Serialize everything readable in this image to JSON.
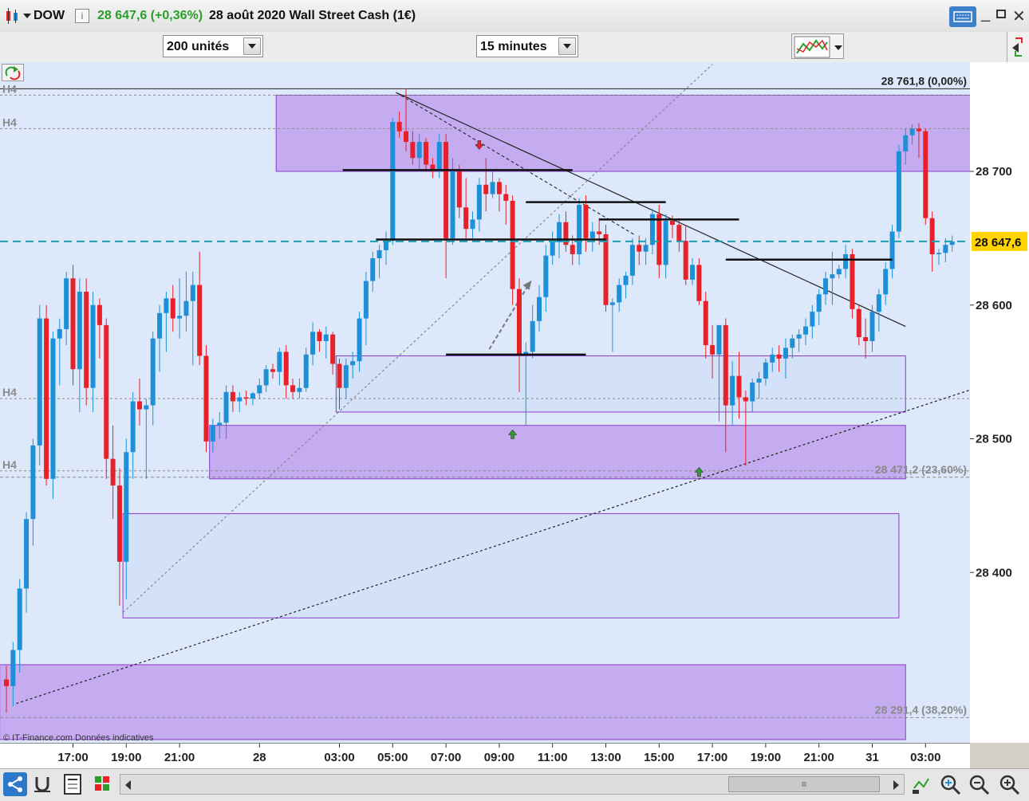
{
  "window": {
    "symbol": "DOW",
    "price_change": "28 647,6 (+0,36%)",
    "title": "28 août 2020 Wall Street Cash (1€)"
  },
  "toolbar": {
    "units": "200 unités",
    "timeframe": "15 minutes"
  },
  "watermark": "© IT-Finance.com Données indicatives",
  "colors": {
    "up": "#1e90d8",
    "down": "#e8202a",
    "zone_purple": "#c3a8ee",
    "zone_blue": "#d2e1f8",
    "last_line": "#1aa0b0",
    "last_tag": "#ffd400"
  },
  "chart_data": {
    "type": "candlestick",
    "ylim": [
      28291.4,
      28775
    ],
    "y_ticks": [
      {
        "value": 28700,
        "label": "28 700"
      },
      {
        "value": 28600,
        "label": "28 600"
      },
      {
        "value": 28500,
        "label": "28 500"
      },
      {
        "value": 28400,
        "label": "28 400"
      }
    ],
    "x_ticks": [
      {
        "i": 10,
        "label": "17:00"
      },
      {
        "i": 18,
        "label": "19:00"
      },
      {
        "i": 26,
        "label": "21:00"
      },
      {
        "i": 38,
        "label": "28"
      },
      {
        "i": 50,
        "label": "03:00"
      },
      {
        "i": 58,
        "label": "05:00"
      },
      {
        "i": 66,
        "label": "07:00"
      },
      {
        "i": 74,
        "label": "09:00"
      },
      {
        "i": 82,
        "label": "11:00"
      },
      {
        "i": 90,
        "label": "13:00"
      },
      {
        "i": 98,
        "label": "15:00"
      },
      {
        "i": 106,
        "label": "17:00"
      },
      {
        "i": 114,
        "label": "19:00"
      },
      {
        "i": 122,
        "label": "21:00"
      },
      {
        "i": 130,
        "label": "31"
      },
      {
        "i": 138,
        "label": "03:00"
      }
    ],
    "last_price": {
      "value": 28647.6,
      "label": "28 647,6"
    },
    "fib_levels": [
      {
        "value": 28761.8,
        "label": "28 761,8 (0,00%)"
      },
      {
        "value": 28471.2,
        "label": "28 471,2 (23,60%)"
      },
      {
        "value": 28291.4,
        "label": "28 291,4 (38,20%)"
      }
    ],
    "h4_lines": [
      {
        "value": 28757,
        "label": "H4"
      },
      {
        "value": 28732,
        "label": "H4"
      },
      {
        "value": 28530,
        "label": "H4"
      },
      {
        "value": 28476,
        "label": "H4"
      }
    ],
    "zones": [
      {
        "from_i": 40.5,
        "to_i": 145,
        "top": 28757,
        "bottom": 28700,
        "kind": "purple"
      },
      {
        "from_i": 49.5,
        "to_i": 135,
        "top": 28562,
        "bottom": 28520,
        "kind": "blue"
      },
      {
        "from_i": 30.5,
        "to_i": 135,
        "top": 28510,
        "bottom": 28470,
        "kind": "purple"
      },
      {
        "from_i": 17.5,
        "to_i": 134,
        "top": 28444,
        "bottom": 28366,
        "kind": "blue"
      },
      {
        "from_i": -1,
        "to_i": 135,
        "top": 28331,
        "bottom": 28275,
        "kind": "purple"
      }
    ],
    "h_lines": [
      {
        "from_i": 50.5,
        "to_i": 85,
        "value": 28701
      },
      {
        "from_i": 55.5,
        "to_i": 90,
        "value": 28649
      },
      {
        "from_i": 66,
        "to_i": 87,
        "value": 28563
      },
      {
        "from_i": 78,
        "to_i": 99,
        "value": 28677
      },
      {
        "from_i": 89,
        "to_i": 110,
        "value": 28664
      },
      {
        "from_i": 108,
        "to_i": 133,
        "value": 28634
      }
    ],
    "trend_lines": [
      {
        "i1": 58.5,
        "v1": 28759,
        "i2": 135,
        "v2": 28584,
        "style": "solid"
      },
      {
        "i1": 58.5,
        "v1": 28759,
        "i2": 94.5,
        "v2": 28652,
        "style": "dashed"
      },
      {
        "i1": 17.5,
        "v1": 28370,
        "i2": 106,
        "v2": 28780,
        "style": "dotted"
      },
      {
        "i1": 1.5,
        "v1": 28302,
        "i2": 145,
        "v2": 28537,
        "style": "dotted_dark"
      },
      {
        "i1": 72.5,
        "v1": 28567,
        "i2": 78.5,
        "v2": 28616,
        "style": "arrow"
      }
    ],
    "markers": [
      {
        "i": 76,
        "value": 28503,
        "dir": "up"
      },
      {
        "i": 104,
        "value": 28475,
        "dir": "up"
      },
      {
        "i": 71,
        "value": 28720,
        "dir": "down"
      }
    ],
    "candles": [
      [
        28320,
        28330,
        28295,
        28315
      ],
      [
        28315,
        28348,
        28300,
        28342
      ],
      [
        28342,
        28395,
        28325,
        28388
      ],
      [
        28388,
        28445,
        28370,
        28440
      ],
      [
        28440,
        28500,
        28420,
        28495
      ],
      [
        28495,
        28600,
        28480,
        28590
      ],
      [
        28590,
        28600,
        28465,
        28470
      ],
      [
        28470,
        28580,
        28455,
        28575
      ],
      [
        28575,
        28590,
        28540,
        28582
      ],
      [
        28582,
        28625,
        28570,
        28620
      ],
      [
        28620,
        28630,
        28540,
        28552
      ],
      [
        28552,
        28620,
        28520,
        28610
      ],
      [
        28610,
        28620,
        28525,
        28538
      ],
      [
        28538,
        28610,
        28520,
        28600
      ],
      [
        28600,
        28605,
        28560,
        28585
      ],
      [
        28585,
        28590,
        28470,
        28485
      ],
      [
        28485,
        28510,
        28440,
        28465
      ],
      [
        28465,
        28478,
        28375,
        28408
      ],
      [
        28408,
        28500,
        28380,
        28490
      ],
      [
        28490,
        28535,
        28470,
        28528
      ],
      [
        28528,
        28545,
        28510,
        28522
      ],
      [
        28522,
        28530,
        28470,
        28525
      ],
      [
        28525,
        28580,
        28510,
        28575
      ],
      [
        28575,
        28600,
        28550,
        28594
      ],
      [
        28594,
        28610,
        28565,
        28605
      ],
      [
        28605,
        28615,
        28580,
        28590
      ],
      [
        28590,
        28620,
        28575,
        28592
      ],
      [
        28592,
        28625,
        28580,
        28603
      ],
      [
        28603,
        28625,
        28555,
        28615
      ],
      [
        28615,
        28640,
        28555,
        28562
      ],
      [
        28562,
        28570,
        28490,
        28498
      ],
      [
        28498,
        28515,
        28490,
        28510
      ],
      [
        28510,
        28520,
        28500,
        28512
      ],
      [
        28512,
        28540,
        28500,
        28535
      ],
      [
        28535,
        28540,
        28520,
        28528
      ],
      [
        28528,
        28535,
        28520,
        28531
      ],
      [
        28531,
        28536,
        28525,
        28530
      ],
      [
        28530,
        28535,
        28525,
        28534
      ],
      [
        28534,
        28545,
        28530,
        28540
      ],
      [
        28540,
        28555,
        28535,
        28552
      ],
      [
        28552,
        28556,
        28545,
        28550
      ],
      [
        28550,
        28568,
        28540,
        28565
      ],
      [
        28565,
        28570,
        28530,
        28540
      ],
      [
        28540,
        28545,
        28530,
        28535
      ],
      [
        28535,
        28545,
        28530,
        28538
      ],
      [
        28538,
        28568,
        28535,
        28563
      ],
      [
        28563,
        28587,
        28555,
        28580
      ],
      [
        28580,
        28582,
        28565,
        28573
      ],
      [
        28573,
        28584,
        28560,
        28578
      ],
      [
        28578,
        28580,
        28548,
        28556
      ],
      [
        28556,
        28560,
        28522,
        28538
      ],
      [
        28538,
        28560,
        28530,
        28555
      ],
      [
        28555,
        28565,
        28545,
        28558
      ],
      [
        28558,
        28595,
        28550,
        28590
      ],
      [
        28590,
        28625,
        28570,
        28618
      ],
      [
        28618,
        28640,
        28610,
        28635
      ],
      [
        28635,
        28645,
        28620,
        28641
      ],
      [
        28641,
        28655,
        28630,
        28648
      ],
      [
        28648,
        28740,
        28645,
        28737
      ],
      [
        28737,
        28745,
        28725,
        28730
      ],
      [
        28730,
        28762,
        28715,
        28722
      ],
      [
        28722,
        28730,
        28705,
        28710
      ],
      [
        28710,
        28728,
        28700,
        28722
      ],
      [
        28722,
        28725,
        28700,
        28705
      ],
      [
        28705,
        28710,
        28695,
        28700
      ],
      [
        28700,
        28728,
        28695,
        28722
      ],
      [
        28722,
        28728,
        28620,
        28650
      ],
      [
        28650,
        28710,
        28645,
        28700
      ],
      [
        28700,
        28705,
        28665,
        28673
      ],
      [
        28673,
        28695,
        28650,
        28657
      ],
      [
        28657,
        28670,
        28650,
        28664
      ],
      [
        28664,
        28695,
        28655,
        28690
      ],
      [
        28690,
        28710,
        28670,
        28683
      ],
      [
        28683,
        28700,
        28680,
        28692
      ],
      [
        28692,
        28695,
        28670,
        28683
      ],
      [
        28683,
        28690,
        28660,
        28678
      ],
      [
        28678,
        28682,
        28600,
        28612
      ],
      [
        28612,
        28620,
        28535,
        28563
      ],
      [
        28563,
        28572,
        28510,
        28565
      ],
      [
        28565,
        28600,
        28560,
        28588
      ],
      [
        28588,
        28615,
        28580,
        28606
      ],
      [
        28606,
        28645,
        28595,
        28637
      ],
      [
        28637,
        28655,
        28630,
        28647
      ],
      [
        28647,
        28668,
        28635,
        28662
      ],
      [
        28662,
        28670,
        28640,
        28645
      ],
      [
        28645,
        28652,
        28630,
        28638
      ],
      [
        28638,
        28680,
        28630,
        28675
      ],
      [
        28675,
        28682,
        28640,
        28650
      ],
      [
        28650,
        28662,
        28640,
        28655
      ],
      [
        28655,
        28665,
        28645,
        28653
      ],
      [
        28653,
        28660,
        28595,
        28600
      ],
      [
        28600,
        28605,
        28565,
        28602
      ],
      [
        28602,
        28620,
        28595,
        28615
      ],
      [
        28615,
        28625,
        28605,
        28622
      ],
      [
        28622,
        28650,
        28615,
        28645
      ],
      [
        28645,
        28652,
        28630,
        28640
      ],
      [
        28640,
        28650,
        28630,
        28645
      ],
      [
        28645,
        28672,
        28638,
        28668
      ],
      [
        28668,
        28675,
        28620,
        28630
      ],
      [
        28630,
        28668,
        28620,
        28663
      ],
      [
        28663,
        28667,
        28650,
        28660
      ],
      [
        28660,
        28665,
        28640,
        28648
      ],
      [
        28648,
        28660,
        28615,
        28619
      ],
      [
        28619,
        28635,
        28615,
        28630
      ],
      [
        28630,
        28635,
        28600,
        28603
      ],
      [
        28603,
        28610,
        28560,
        28570
      ],
      [
        28570,
        28585,
        28545,
        28563
      ],
      [
        28563,
        28582,
        28513,
        28585
      ],
      [
        28585,
        28590,
        28490,
        28525
      ],
      [
        28525,
        28558,
        28510,
        28547
      ],
      [
        28547,
        28565,
        28515,
        28531
      ],
      [
        28531,
        28536,
        28480,
        28528
      ],
      [
        28528,
        28545,
        28520,
        28542
      ],
      [
        28542,
        28550,
        28530,
        28545
      ],
      [
        28545,
        28560,
        28540,
        28557
      ],
      [
        28557,
        28568,
        28550,
        28563
      ],
      [
        28563,
        28570,
        28550,
        28560
      ],
      [
        28560,
        28575,
        28545,
        28568
      ],
      [
        28568,
        28578,
        28560,
        28575
      ],
      [
        28575,
        28582,
        28565,
        28578
      ],
      [
        28578,
        28590,
        28570,
        28584
      ],
      [
        28584,
        28600,
        28575,
        28595
      ],
      [
        28595,
        28612,
        28585,
        28608
      ],
      [
        28608,
        28625,
        28600,
        28620
      ],
      [
        28620,
        28640,
        28600,
        28623
      ],
      [
        28623,
        28630,
        28620,
        28627
      ],
      [
        28627,
        28645,
        28620,
        28638
      ],
      [
        28638,
        28642,
        28590,
        28597
      ],
      [
        28597,
        28600,
        28570,
        28576
      ],
      [
        28576,
        28590,
        28560,
        28573
      ],
      [
        28573,
        28600,
        28565,
        28595
      ],
      [
        28595,
        28612,
        28580,
        28608
      ],
      [
        28608,
        28632,
        28600,
        28627
      ],
      [
        28627,
        28660,
        28620,
        28655
      ],
      [
        28655,
        28720,
        28650,
        28715
      ],
      [
        28715,
        28732,
        28705,
        28727
      ],
      [
        28727,
        28735,
        28720,
        28732
      ],
      [
        28732,
        28736,
        28710,
        28730
      ],
      [
        28730,
        28732,
        28660,
        28665
      ],
      [
        28665,
        28670,
        28625,
        28638
      ],
      [
        28638,
        28642,
        28630,
        28639
      ],
      [
        28639,
        28650,
        28632,
        28645
      ],
      [
        28645,
        28652,
        28640,
        28647.6
      ]
    ]
  },
  "bottombar": {
    "scroll_label": "≡"
  }
}
